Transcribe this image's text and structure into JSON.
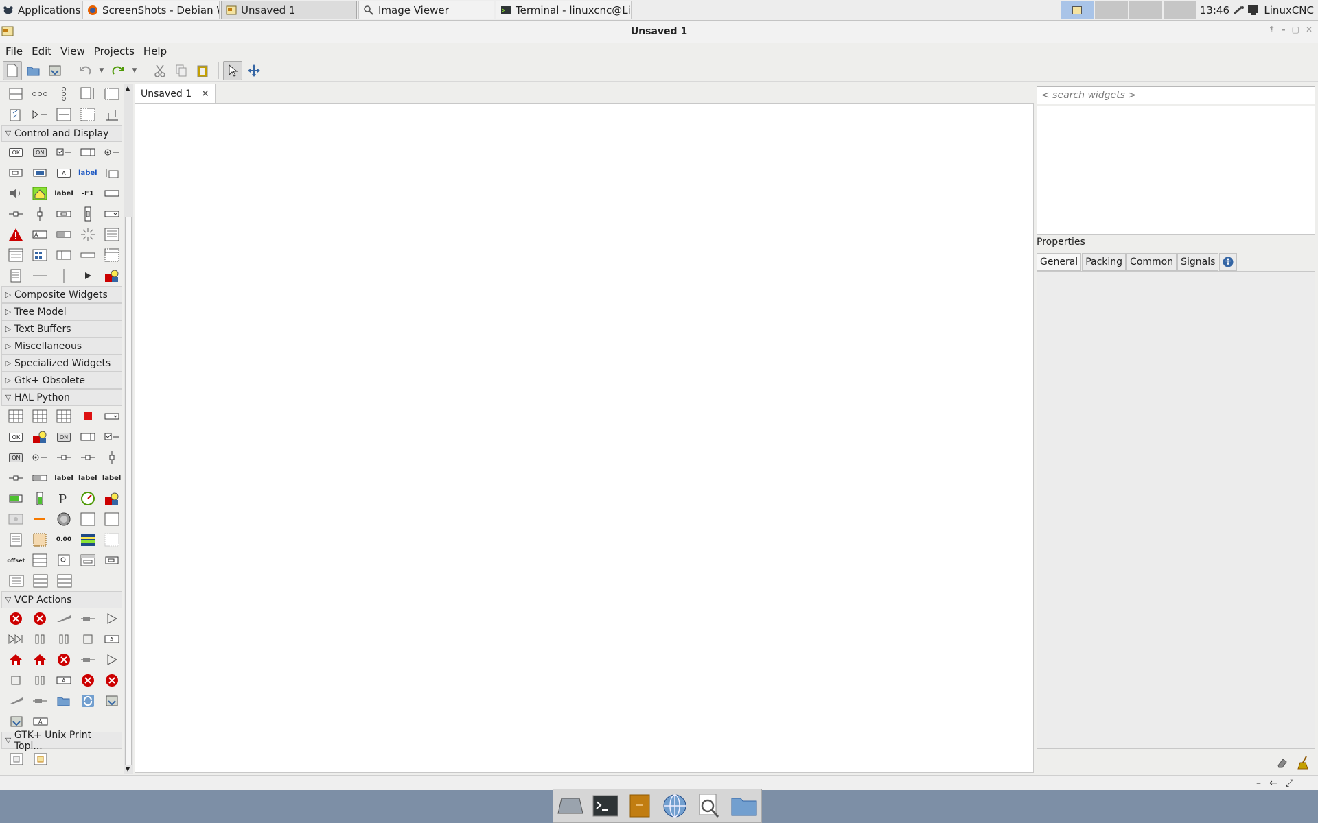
{
  "panel": {
    "applications": "Applications",
    "tasks": [
      "ScreenShots - Debian W...",
      "Unsaved 1",
      "Image Viewer",
      "Terminal - linuxcnc@Lin..."
    ],
    "clock": "13:46",
    "user": "LinuxCNC"
  },
  "window": {
    "title": "Unsaved 1",
    "menu": [
      "File",
      "Edit",
      "View",
      "Projects",
      "Help"
    ]
  },
  "palette": {
    "groups": {
      "control": "Control and Display",
      "composite": "Composite Widgets",
      "tree": "Tree Model",
      "textbuf": "Text Buffers",
      "misc": "Miscellaneous",
      "special": "Specialized Widgets",
      "obsolete": "Gtk+ Obsolete",
      "hal": "HAL Python",
      "vcp": "VCP Actions",
      "print": "GTK+ Unix Print Topl..."
    },
    "glyphs": {
      "ok": "OK",
      "on": "ON",
      "label": "label",
      "f1": "-F1",
      "a": "A",
      "zero": "0.00",
      "offset": "offset"
    }
  },
  "editor": {
    "tab_label": "Unsaved 1",
    "close_glyph": "✕"
  },
  "inspector": {
    "search_placeholder": "< search widgets >",
    "properties_title": "Properties",
    "tabs": [
      "General",
      "Packing",
      "Common",
      "Signals"
    ]
  },
  "colors": {
    "accent": "#3465a4",
    "error_red": "#cc0000",
    "desktop": "#7d8fa6"
  }
}
